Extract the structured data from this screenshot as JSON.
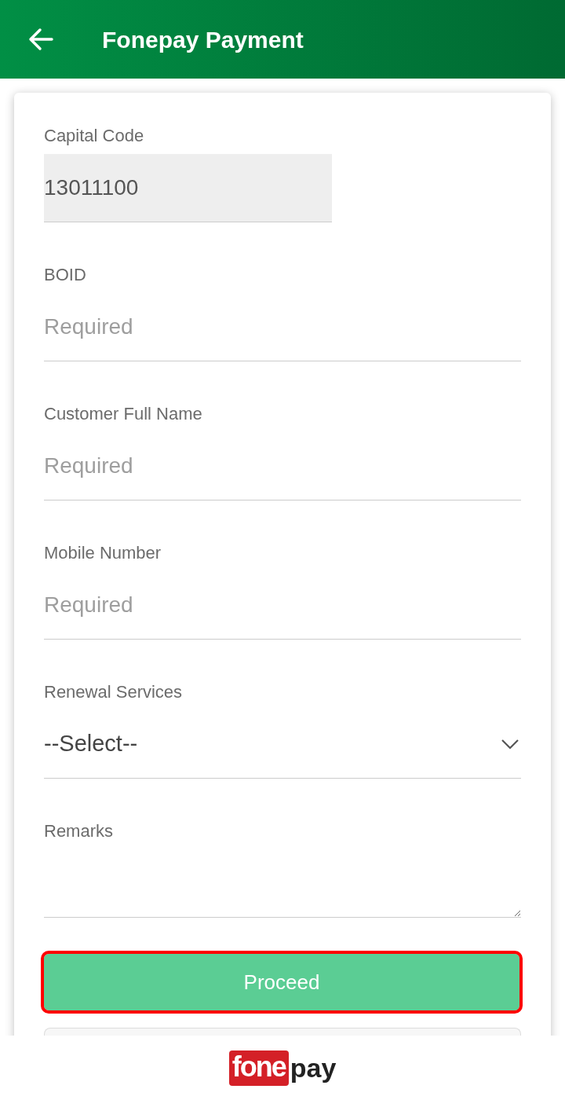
{
  "app_bar": {
    "title": "Fonepay Payment"
  },
  "fields": [
    {
      "kind": "readonly",
      "label": "Capital Code",
      "value": "13011100"
    },
    {
      "kind": "text",
      "label": "BOID",
      "placeholder": "Required"
    },
    {
      "kind": "text",
      "label": "Customer Full Name",
      "placeholder": "Required"
    },
    {
      "kind": "text",
      "label": "Mobile Number",
      "placeholder": "Required"
    },
    {
      "kind": "select",
      "label": "Renewal Services",
      "value": "--Select--"
    },
    {
      "kind": "textarea",
      "label": "Remarks"
    }
  ],
  "proceed_button": {
    "label": "Proceed",
    "highlighted": true
  },
  "footer_logo": {
    "part_1": "fone",
    "part_2": "pay"
  }
}
